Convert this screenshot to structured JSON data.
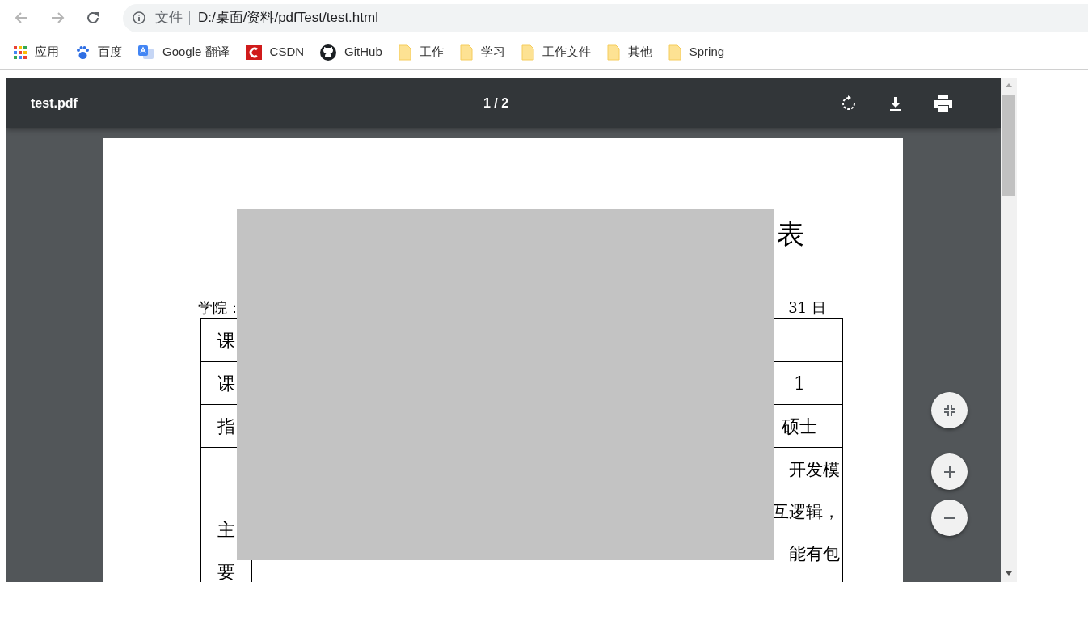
{
  "browser": {
    "nav": [
      {
        "kind": "back",
        "disabled": true
      },
      {
        "kind": "forward",
        "disabled": true
      },
      {
        "kind": "reload",
        "disabled": false
      }
    ],
    "address": {
      "scheme_label": "文件",
      "url": "D:/桌面/资料/pdfTest/test.html"
    },
    "bookmarks": [
      {
        "label": "应用",
        "kind": "apps"
      },
      {
        "label": "百度",
        "kind": "baidu"
      },
      {
        "label": "Google 翻译",
        "kind": "translate"
      },
      {
        "label": "CSDN",
        "kind": "csdn"
      },
      {
        "label": "GitHub",
        "kind": "github"
      },
      {
        "label": "工作",
        "kind": "folder"
      },
      {
        "label": "学习",
        "kind": "folder"
      },
      {
        "label": "工作文件",
        "kind": "folder"
      },
      {
        "label": "其他",
        "kind": "folder"
      },
      {
        "label": "Spring",
        "kind": "folder"
      }
    ]
  },
  "pdf_viewer": {
    "file_name": "test.pdf",
    "page_indicator": "1 / 2",
    "toolbar_actions": [
      {
        "kind": "rotate"
      },
      {
        "kind": "download"
      },
      {
        "kind": "print"
      }
    ],
    "zoom_controls": [
      {
        "kind": "fit"
      },
      {
        "kind": "zoom_in"
      },
      {
        "kind": "zoom_out"
      }
    ],
    "document": {
      "title_fragment": "表",
      "header_left": "学院：",
      "header_right": "31 日",
      "rows": [
        {
          "kind": "single",
          "label": "课"
        },
        {
          "kind": "single",
          "label": "课",
          "value": "1"
        },
        {
          "kind": "single",
          "label": "指",
          "value": "硕士"
        },
        {
          "kind": "multi",
          "label_chars": [
            "主",
            "要"
          ],
          "lines": [
            "开发模",
            "互逻辑，",
            "能有包"
          ]
        }
      ],
      "redacted": true
    }
  }
}
